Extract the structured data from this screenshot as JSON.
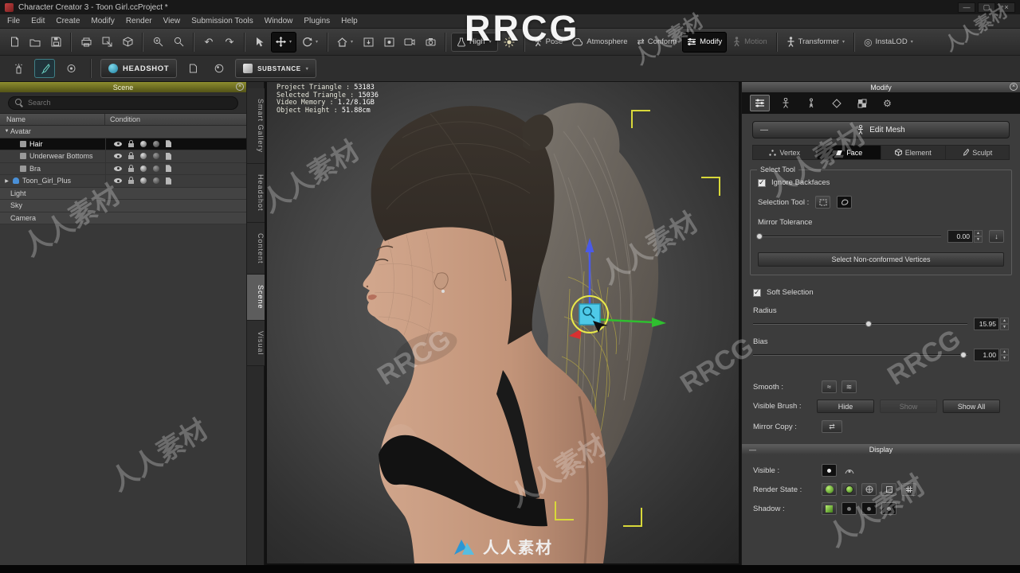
{
  "window": {
    "title": "Character Creator 3 - Toon Girl.ccProject *"
  },
  "menus": [
    "File",
    "Edit",
    "Create",
    "Modify",
    "Render",
    "View",
    "Submission Tools",
    "Window",
    "Plugins",
    "Help"
  ],
  "toolbar": {
    "quality_label": "High",
    "pose": "Pose",
    "atmosphere": "Atmosphere",
    "conform": "Conform",
    "modify": "Modify",
    "motion": "Motion",
    "transformer": "Transformer",
    "instalod": "InstaLOD"
  },
  "plugins_bar": {
    "headshot": "HEADSHOT",
    "substance": "SUBSTANCE"
  },
  "side_tabs": [
    "Smart Gallery",
    "Headshot",
    "Content",
    "Scene",
    "Visual"
  ],
  "scene_panel": {
    "title": "Scene",
    "search_placeholder": "Search",
    "columns": [
      "Name",
      "Condition"
    ],
    "rows": [
      "Avatar",
      "Hair",
      "Underwear Bottoms",
      "Bra",
      "Toon_Girl_Plus",
      "Light",
      "Sky",
      "Camera"
    ]
  },
  "viewport": {
    "stats": [
      {
        "label": "Project Triangle :",
        "value": "53183"
      },
      {
        "label": "Selected Triangle :",
        "value": "15036"
      },
      {
        "label": "Video Memory :",
        "value": "1.2/8.1GB"
      },
      {
        "label": "Object Height :",
        "value": "51.88cm"
      }
    ]
  },
  "modify_panel": {
    "title": "Modify",
    "edit_mesh": "Edit Mesh",
    "modes": [
      "Vertex",
      "Face",
      "Element",
      "Sculpt"
    ],
    "select_tool": {
      "legend": "Select Tool",
      "ignore_backfaces": "Ignore Backfaces",
      "selection_tool": "Selection Tool :",
      "mirror_tolerance": "Mirror Tolerance",
      "mirror_tolerance_value": "0.00",
      "non_conformed": "Select Non-conformed Vertices"
    },
    "soft_selection": "Soft Selection",
    "radius": "Radius",
    "radius_value": "15.95",
    "bias": "Bias",
    "bias_value": "1.00",
    "smooth": "Smooth :",
    "visible_brush": "Visible Brush :",
    "hide": "Hide",
    "show": "Show",
    "show_all": "Show All",
    "mirror_copy": "Mirror Copy :",
    "display": {
      "title": "Display",
      "visible": "Visible :",
      "render_state": "Render State :",
      "shadow": "Shadow :"
    }
  },
  "watermarks": {
    "brand": "RRCG",
    "site": "人人素材"
  }
}
